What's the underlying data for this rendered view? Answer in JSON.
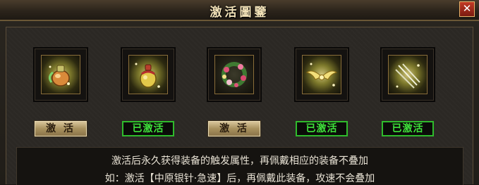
{
  "window": {
    "title": "激活圖鑒",
    "close_label": "✕"
  },
  "slots": [
    {
      "icon": "potion-bottle-icon",
      "button_label": "激 活",
      "activated": false
    },
    {
      "icon": "gold-flask-icon",
      "button_label": "已激活",
      "activated": true
    },
    {
      "icon": "flower-wreath-icon",
      "button_label": "激 活",
      "activated": false
    },
    {
      "icon": "golden-wings-icon",
      "button_label": "已激活",
      "activated": true
    },
    {
      "icon": "silver-needles-icon",
      "button_label": "已激活",
      "activated": true
    }
  ],
  "description": {
    "line1": "激活后永久获得装备的触发属性，再佩戴相应的装备不叠加",
    "line2": "如：激活【中原银针·急速】后，再佩戴此装备，攻速不会叠加"
  },
  "colors": {
    "activate_button": "#bda775",
    "activated_text": "#3fe33b",
    "title_text": "#f2e2b8"
  }
}
